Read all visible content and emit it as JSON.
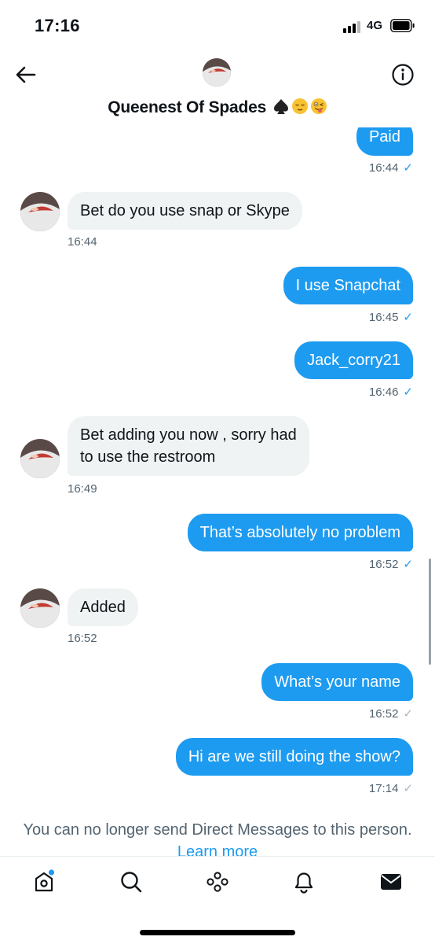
{
  "status_bar": {
    "time": "17:16",
    "network": "4G",
    "signal_bars_active": 3,
    "signal_bars_total": 4
  },
  "header": {
    "title": "Queenest Of Spades",
    "title_emoji": [
      "spade-emoji",
      "relieved-face-emoji",
      "winking-tongue-emoji"
    ],
    "back_icon": "arrow-left-icon",
    "info_icon": "info-icon"
  },
  "messages": [
    {
      "direction": "sent",
      "text": "Paid",
      "time": "16:44",
      "status": "read"
    },
    {
      "direction": "received",
      "text": "Bet do you use snap or Skype",
      "time": "16:44"
    },
    {
      "direction": "sent",
      "text": "I use Snapchat",
      "time": "16:45",
      "status": "read"
    },
    {
      "direction": "sent",
      "text": "Jack_corry21",
      "time": "16:46",
      "status": "read"
    },
    {
      "direction": "received",
      "text_lines": [
        "Bet adding you now , sorry had",
        "to use the restroom"
      ],
      "time": "16:49"
    },
    {
      "direction": "sent",
      "text": "That’s absolutely no problem",
      "time": "16:52",
      "status": "read"
    },
    {
      "direction": "received",
      "text": "Added",
      "time": "16:52"
    },
    {
      "direction": "sent",
      "text": "What’s your name",
      "time": "16:52",
      "status": "sent"
    },
    {
      "direction": "sent",
      "text": "Hi are we still doing the show?",
      "time": "17:14",
      "status": "sent"
    }
  ],
  "footer": {
    "notice": "You can no longer send Direct Messages to this person.",
    "learn_more": "Learn more"
  },
  "tabbar": {
    "items": [
      "home-icon",
      "search-icon",
      "spaces-icon",
      "notifications-icon",
      "messages-icon"
    ],
    "accent": "#1d9bf0"
  },
  "colors": {
    "sent_bubble": "#1d9bf0",
    "received_bubble": "#eff3f4",
    "muted_text": "#536471"
  }
}
